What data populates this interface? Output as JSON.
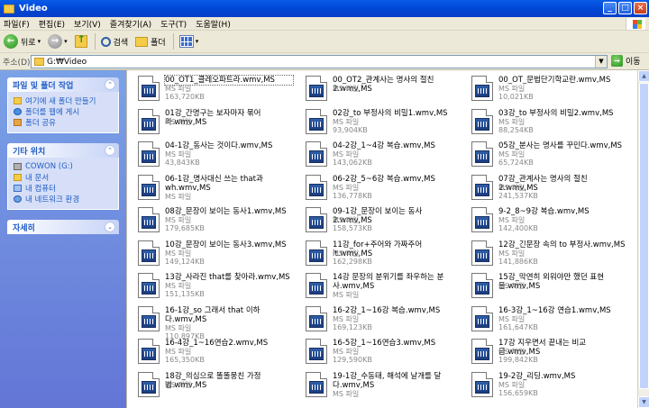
{
  "window": {
    "title": "Video"
  },
  "menu": [
    "파일(F)",
    "편집(E)",
    "보기(V)",
    "즐겨찾기(A)",
    "도구(T)",
    "도움말(H)"
  ],
  "toolbar": {
    "back": "뒤로",
    "search": "검색",
    "folders": "폴더"
  },
  "address": {
    "label": "주소(D)",
    "value": "G:₩Video",
    "go": "이동"
  },
  "sidebar": {
    "tasks": {
      "title": "파일 및 폴더 작업",
      "items": [
        "여기에 새 폴더 만들기",
        "폴더를 웹에 게시",
        "폴더 공유"
      ]
    },
    "places": {
      "title": "기타 위치",
      "items": [
        "COWON (G:)",
        "내 문서",
        "내 컴퓨터",
        "내 네트워크 환경"
      ]
    },
    "details": {
      "title": "자세히"
    }
  },
  "files": [
    {
      "name": "00_OT1_클레오파트라.wmv,MS",
      "type": "MS 파일",
      "size": "163,720KB"
    },
    {
      "name": "00_OT2_관계사는 명사의 절친2.wmv,MS",
      "type": "MS 파일",
      "size": ""
    },
    {
      "name": "00_OT_문법단기학교란.wmv,MS",
      "type": "MS 파일",
      "size": "10,021KB"
    },
    {
      "name": "01강_간명구는 보자마자 묶어라.wmv,MS",
      "type": "MS 파일",
      "size": ""
    },
    {
      "name": "02강_to 부정사의 비밀1.wmv,MS",
      "type": "MS 파일",
      "size": "93,904KB"
    },
    {
      "name": "03강_to 부정사의 비밀2.wmv,MS",
      "type": "MS 파일",
      "size": "88,254KB"
    },
    {
      "name": "04-1강_동사는 것이다.wmv,MS",
      "type": "MS 파일",
      "size": "43,843KB"
    },
    {
      "name": "04-2강_1~4강 복습.wmv,MS",
      "type": "MS 파일",
      "size": "143,062KB"
    },
    {
      "name": "05강_분사는 명사를 꾸민다.wmv,MS",
      "type": "MS 파일",
      "size": "65,724KB"
    },
    {
      "name": "06-1강_명사대신 쓰는 that과 wh.wmv,MS",
      "type": "MS 파일",
      "size": ""
    },
    {
      "name": "06-2강_5~6강 복습.wmv,MS",
      "type": "MS 파일",
      "size": "136,778KB"
    },
    {
      "name": "07강_관계사는 명사의 절친2.wmv,MS",
      "type": "MS 파일",
      "size": "241,537KB"
    },
    {
      "name": "08강_문장이 보이는 동사1.wmv,MS",
      "type": "MS 파일",
      "size": "179,685KB"
    },
    {
      "name": "09-1강_문장이 보이는 동사2.wmv,MS",
      "type": "MS 파일",
      "size": "158,573KB"
    },
    {
      "name": "9-2_8~9강 복습.wmv,MS",
      "type": "MS 파일",
      "size": "142,400KB"
    },
    {
      "name": "10강_문장이 보이는 동사3.wmv,MS",
      "type": "MS 파일",
      "size": "149,124KB"
    },
    {
      "name": "11강_for+주어와 가짜주어 it.wmv,MS",
      "type": "MS 파일",
      "size": "162,298KB"
    },
    {
      "name": "12강_긴문장 속의 to 부정사.wmv,MS",
      "type": "MS 파일",
      "size": "141,886KB"
    },
    {
      "name": "13강_사라진 that를 찾아라.wmv,MS",
      "type": "MS 파일",
      "size": "151,135KB"
    },
    {
      "name": "14강 문장의 분위기를 좌우하는 분사.wmv,MS",
      "type": "MS 파일",
      "size": ""
    },
    {
      "name": "15강_막연히 외워야만 했던 표현들.wmv,MS",
      "type": "MS 파일",
      "size": ""
    },
    {
      "name": "16-1강_so 그래서 that 이하다.wmv,MS",
      "type": "MS 파일",
      "size": "110,897KB"
    },
    {
      "name": "16-2강_1~16강 복습.wmv,MS",
      "type": "MS 파일",
      "size": "169,123KB"
    },
    {
      "name": "16-3강_1~16강 연습1.wmv,MS",
      "type": "MS 파일",
      "size": "161,647KB"
    },
    {
      "name": "16-4강_1~16연습2.wmv,MS",
      "type": "MS 파일",
      "size": "165,350KB"
    },
    {
      "name": "16-5강_1~16연습3.wmv,MS",
      "type": "MS 파일",
      "size": "129,590KB"
    },
    {
      "name": "17강 지우면서 끝내는 비교급.wmv,MS",
      "type": "MS 파일",
      "size": "199,842KB"
    },
    {
      "name": "18강_의심으로 똘똘뭉친 가정법.wmv,MS",
      "type": "MS 파일",
      "size": ""
    },
    {
      "name": "19-1강_수동태, 해석에 날개를 달다.wmv,MS",
      "type": "MS 파일",
      "size": ""
    },
    {
      "name": "19-2강_리딩.wmv,MS",
      "type": "MS 파일",
      "size": "156,659KB"
    }
  ]
}
